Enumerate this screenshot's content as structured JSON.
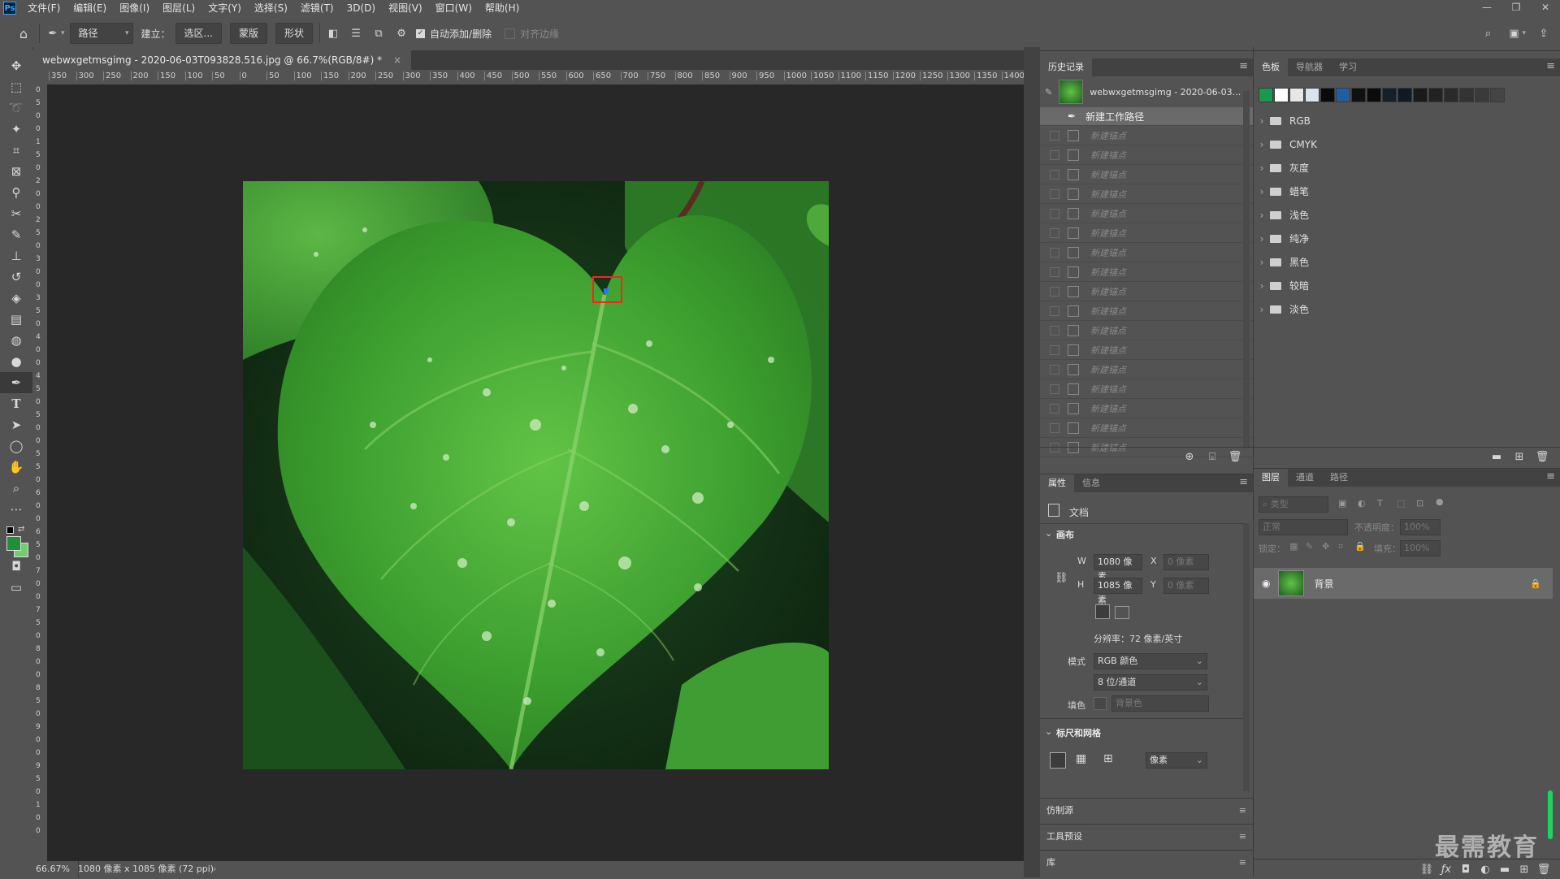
{
  "app": {
    "logo": "Ps"
  },
  "menu": [
    "文件(F)",
    "编辑(E)",
    "图像(I)",
    "图层(L)",
    "文字(Y)",
    "选择(S)",
    "滤镜(T)",
    "3D(D)",
    "视图(V)",
    "窗口(W)",
    "帮助(H)"
  ],
  "options_bar": {
    "mode_select": "路径",
    "make_label": "建立：",
    "selection_btn": "选区...",
    "mask_btn": "蒙版",
    "shape_btn": "形状",
    "auto_add_delete": "自动添加/删除",
    "align_edges": "对齐边缘"
  },
  "document": {
    "tab_title": "webwxgetmsgimg - 2020-06-03T093828.516.jpg @ 66.7%(RGB/8#) *",
    "ruler_ticks_h": [
      "350",
      "300",
      "250",
      "200",
      "150",
      "100",
      "50",
      "0",
      "50",
      "100",
      "150",
      "200",
      "250",
      "300",
      "350",
      "400",
      "450",
      "500",
      "550",
      "600",
      "650",
      "700",
      "750",
      "800",
      "850",
      "900",
      "950",
      "1000",
      "1050",
      "1100",
      "1150",
      "1200",
      "1250",
      "1300",
      "1350",
      "1400"
    ],
    "ruler_ticks_v": [
      "0",
      "5",
      "0",
      "0",
      "1",
      "5",
      "0",
      "2",
      "0",
      "0",
      "2",
      "5",
      "0",
      "3",
      "0",
      "0",
      "3",
      "5",
      "0",
      "4",
      "0",
      "0",
      "4",
      "5",
      "0",
      "5",
      "0",
      "0",
      "5",
      "5",
      "0",
      "6",
      "0",
      "0",
      "6",
      "5",
      "0",
      "7",
      "0",
      "0",
      "7",
      "5",
      "0",
      "8",
      "0",
      "0",
      "8",
      "5",
      "0",
      "9",
      "0",
      "0",
      "9",
      "5",
      "0",
      "1",
      "0",
      "0"
    ],
    "zoom": "66.67%",
    "doc_info": "1080 像素 x 1085 像素 (72 ppi)"
  },
  "history_panel": {
    "title": "历史记录",
    "snapshot": "webwxgetmsgimg - 2020-06-03...",
    "current_step": "新建工作路径",
    "steps": [
      "新建锚点",
      "新建锚点",
      "新建锚点",
      "新建锚点",
      "新建锚点",
      "新建锚点",
      "新建锚点",
      "新建锚点",
      "新建锚点",
      "新建锚点",
      "新建锚点",
      "新建锚点",
      "新建锚点",
      "新建锚点",
      "新建锚点",
      "新建锚点",
      "新建锚点"
    ]
  },
  "swatches_panel": {
    "tabs": [
      "色板",
      "导航器",
      "学习"
    ],
    "colors": [
      "#1a9850",
      "#ffffff",
      "#e6e6e6",
      "#d8e4f0",
      "#0a0a0a",
      "#1f5fa0",
      "#111111",
      "#0b0b0b",
      "#14202a",
      "#0f1a24",
      "#1a1a1a",
      "#222222",
      "#2a2a2a",
      "#333333",
      "#3a3a3a",
      "#444444"
    ],
    "groups": [
      "RGB",
      "CMYK",
      "灰度",
      "蜡笔",
      "浅色",
      "纯净",
      "黑色",
      "较暗",
      "淡色"
    ]
  },
  "properties_panel": {
    "tabs": [
      "属性",
      "信息"
    ],
    "doc_label": "文档",
    "canvas_section": "画布",
    "w_label": "W",
    "w_value": "1080 像素",
    "h_label": "H",
    "h_value": "1085 像素",
    "x_label": "X",
    "x_value": "0 像素",
    "y_label": "Y",
    "y_value": "0 像素",
    "resolution": "分辨率：72 像素/英寸",
    "mode_label": "模式",
    "mode_value": "RGB 颜色",
    "depth_value": "8 位/通道",
    "fill_label": "填色",
    "fill_value": "背景色",
    "rulers_section": "标尺和网格",
    "units_value": "像素"
  },
  "layers_panel": {
    "tabs": [
      "图层",
      "通道",
      "路径"
    ],
    "filter_placeholder": "类型",
    "blend_mode": "正常",
    "opacity_label": "不透明度：",
    "opacity_value": "100%",
    "lock_label": "锁定：",
    "fill_label": "填充：",
    "fill_value": "100%",
    "layer_name": "背景"
  },
  "collapsed_panels": [
    "仿制源",
    "工具预设",
    "库"
  ],
  "watermark": "最需教育"
}
